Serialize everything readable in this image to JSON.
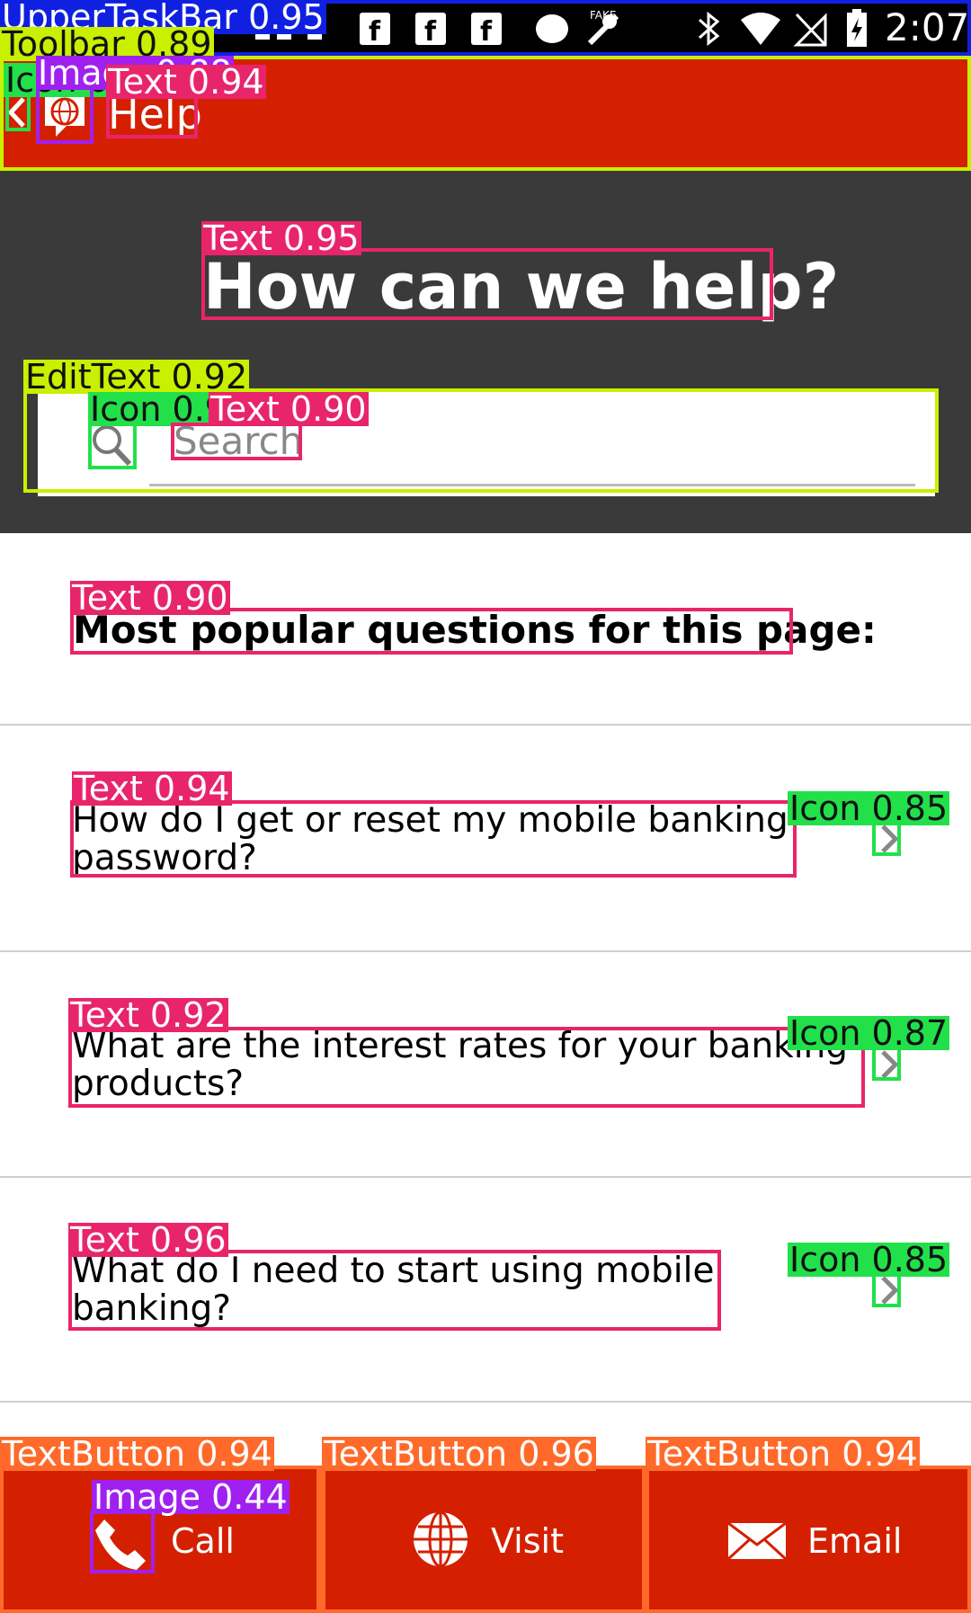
{
  "status_bar": {
    "time": "2:07",
    "fake_label": "FAKE"
  },
  "toolbar": {
    "title": "Help",
    "back_icon": "chevron-left",
    "logo_icon": "globe-chat"
  },
  "header": {
    "heading": "How can we help?"
  },
  "search": {
    "placeholder": "Search",
    "icon": "magnifier"
  },
  "section": {
    "heading": "Most popular questions for this page:"
  },
  "questions": [
    {
      "text": "How do I get or reset my mobile banking password?"
    },
    {
      "text": "What are the interest rates for your banking products?"
    },
    {
      "text": "What do I need to start using mobile banking?"
    }
  ],
  "bottom_bar": {
    "buttons": [
      {
        "label": "Call",
        "icon": "phone"
      },
      {
        "label": "Visit",
        "icon": "globe"
      },
      {
        "label": "Email",
        "icon": "envelope"
      }
    ]
  },
  "detections": {
    "upper_task_bar": "UpperTaskBar 0.95",
    "toolbar": "Toolbar 0.89",
    "icon_back": "Icon 0.88",
    "image_logo": "Image 0.88",
    "text_help": "Text 0.94",
    "text_heading": "Text 0.95",
    "edittext": "EditText 0.92",
    "icon_search": "Icon 0.91",
    "text_search": "Text 0.90",
    "text_popular": "Text 0.90",
    "text_q1": "Text 0.94",
    "icon_q1": "Icon 0.85",
    "text_q2": "Text 0.92",
    "icon_q2": "Icon 0.87",
    "text_q3": "Text 0.96",
    "icon_q3": "Icon 0.85",
    "textbutton_call": "TextButton 0.94",
    "textbutton_visit": "TextButton 0.96",
    "textbutton_email": "TextButton 0.94",
    "image_phone": "Image 0.44"
  },
  "colors": {
    "toolbar_red": "#D42000",
    "hero_dark": "#3A3A3A",
    "box_text": "#E8256A",
    "box_icon": "#22E04A",
    "box_image": "#A020F0",
    "box_edittext": "#C8F000",
    "box_taskbar": "#1020E0",
    "box_textbutton": "#FF6A2A"
  }
}
